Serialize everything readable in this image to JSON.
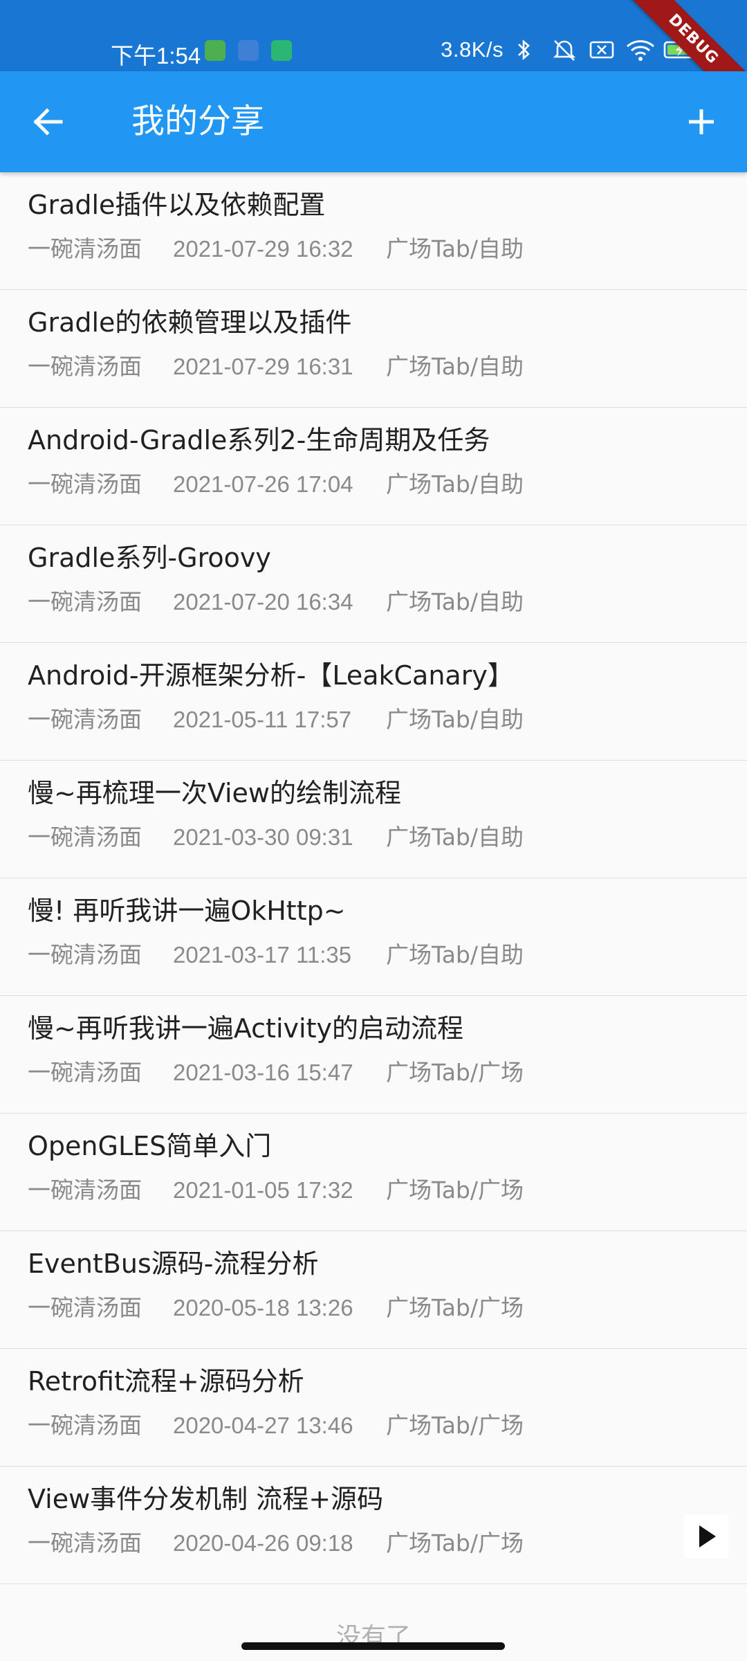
{
  "status_bar": {
    "time": "下午1:54",
    "speed": "3.8K/s",
    "debug_label": "DEBUG"
  },
  "app_bar": {
    "title": "我的分享",
    "back_icon": "arrow-left-icon",
    "add_icon": "plus-icon",
    "color": "#2196f3"
  },
  "list": {
    "items": [
      {
        "title": "Gradle插件以及依赖配置",
        "author": "一碗清汤面",
        "date": "2021-07-29 16:32",
        "category": "广场Tab/自助"
      },
      {
        "title": "Gradle的依赖管理以及插件",
        "author": "一碗清汤面",
        "date": "2021-07-29 16:31",
        "category": "广场Tab/自助"
      },
      {
        "title": "Android-Gradle系列2-生命周期及任务",
        "author": "一碗清汤面",
        "date": "2021-07-26 17:04",
        "category": "广场Tab/自助"
      },
      {
        "title": "Gradle系列-Groovy",
        "author": "一碗清汤面",
        "date": "2021-07-20 16:34",
        "category": "广场Tab/自助"
      },
      {
        "title": "Android-开源框架分析-【LeakCanary】",
        "author": "一碗清汤面",
        "date": "2021-05-11 17:57",
        "category": "广场Tab/自助"
      },
      {
        "title": "慢~再梳理一次View的绘制流程",
        "author": "一碗清汤面",
        "date": "2021-03-30 09:31",
        "category": "广场Tab/自助"
      },
      {
        "title": "慢! 再听我讲一遍OkHttp~",
        "author": "一碗清汤面",
        "date": "2021-03-17 11:35",
        "category": "广场Tab/自助"
      },
      {
        "title": "慢~再听我讲一遍Activity的启动流程",
        "author": "一碗清汤面",
        "date": "2021-03-16 15:47",
        "category": "广场Tab/广场"
      },
      {
        "title": "OpenGLES简单入门",
        "author": "一碗清汤面",
        "date": "2021-01-05 17:32",
        "category": "广场Tab/广场"
      },
      {
        "title": "EventBus源码-流程分析",
        "author": "一碗清汤面",
        "date": "2020-05-18 13:26",
        "category": "广场Tab/广场"
      },
      {
        "title": "Retrofit流程+源码分析",
        "author": "一碗清汤面",
        "date": "2020-04-27 13:46",
        "category": "广场Tab/广场"
      },
      {
        "title": "View事件分发机制 流程+源码",
        "author": "一碗清汤面",
        "date": "2020-04-26 09:18",
        "category": "广场Tab/广场"
      }
    ],
    "footer": "没有了"
  },
  "floating": {
    "play_icon": "play-icon"
  }
}
